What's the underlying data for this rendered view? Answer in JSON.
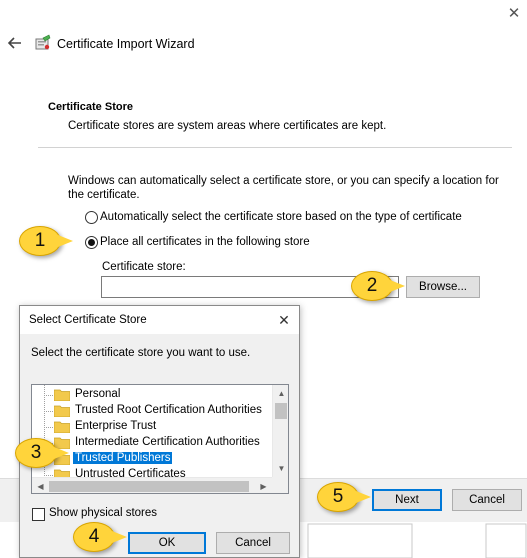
{
  "window": {
    "close_glyph": "✕"
  },
  "wizard": {
    "title": "Certificate Import Wizard",
    "section_title": "Certificate Store",
    "section_desc": "Certificate stores are system areas where certificates are kept.",
    "intro": "Windows can automatically select a certificate store, or you can specify a location for the certificate.",
    "radio_auto": "Automatically select the certificate store based on the type of certificate",
    "radio_place": "Place all certificates in the following store",
    "radio_selected": "place",
    "store_label": "Certificate store:",
    "store_value": "",
    "browse_label": "Browse...",
    "next_label": "Next",
    "cancel_label": "Cancel"
  },
  "dialog": {
    "title": "Select Certificate Store",
    "close_glyph": "✕",
    "description": "Select the certificate store you want to use.",
    "stores": [
      {
        "label": "Personal",
        "selected": false
      },
      {
        "label": "Trusted Root Certification Authorities",
        "selected": false
      },
      {
        "label": "Enterprise Trust",
        "selected": false
      },
      {
        "label": "Intermediate Certification Authorities",
        "selected": false
      },
      {
        "label": "Trusted Publishers",
        "selected": true
      },
      {
        "label": "Untrusted Certificates",
        "selected": false
      }
    ],
    "scroll_up": "▲",
    "scroll_down": "▼",
    "scroll_left": "◀",
    "scroll_right": "▶",
    "show_physical_label": "Show physical stores",
    "show_physical_checked": false,
    "ok_label": "OK",
    "cancel_label": "Cancel"
  },
  "callouts": [
    "1",
    "2",
    "3",
    "4",
    "5"
  ],
  "colors": {
    "accent": "#0078d7",
    "callout": "#ffd43b",
    "folder": "#f2c94c"
  },
  "icons": [
    "back-arrow-icon",
    "certificate-icon",
    "folder-icon",
    "close-icon"
  ]
}
